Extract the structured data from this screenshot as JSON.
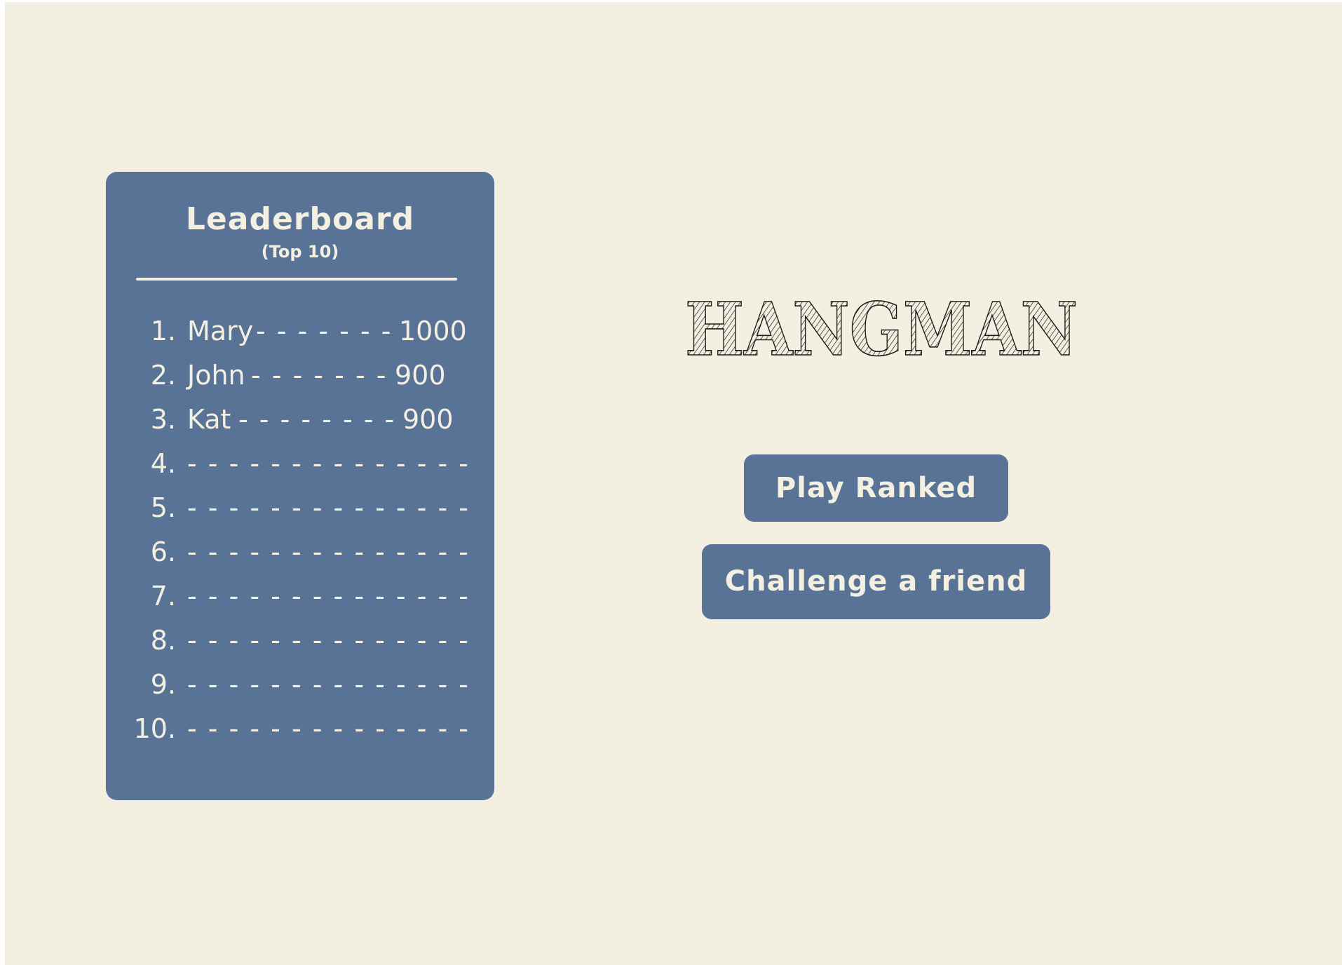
{
  "leaderboard": {
    "title": "Leaderboard",
    "subtitle": "(Top 10)",
    "entries": [
      {
        "rank": "1.",
        "name": "Mary",
        "dashes": "- - - - - - -",
        "score": "1000"
      },
      {
        "rank": "2.",
        "name": "John",
        "dashes": "- - - - - - -",
        "score": "900"
      },
      {
        "rank": "3.",
        "name": "Kat",
        "dashes": "- - - - - - - -",
        "score": "900"
      },
      {
        "rank": "4.",
        "name": "",
        "dashes": "- - - - - - - - - - - - - -",
        "score": ""
      },
      {
        "rank": "5.",
        "name": "",
        "dashes": "- - - - - - - - - - - - - -",
        "score": ""
      },
      {
        "rank": "6.",
        "name": "",
        "dashes": "- - - - - - - - - - - - - -",
        "score": ""
      },
      {
        "rank": "7.",
        "name": "",
        "dashes": "- - - - - - - - - - - - - -",
        "score": ""
      },
      {
        "rank": "8.",
        "name": "",
        "dashes": "- - - - - - - - - - - - - -",
        "score": ""
      },
      {
        "rank": "9.",
        "name": "",
        "dashes": "- - - - - - - - - - - - - -",
        "score": ""
      },
      {
        "rank": "10.",
        "name": "",
        "dashes": "- - - - - - - - - - - - - -",
        "score": ""
      }
    ]
  },
  "game_title": "HANGMAN",
  "buttons": {
    "play_ranked": "Play Ranked",
    "challenge_friend": "Challenge a friend"
  },
  "colors": {
    "background": "#f4f0e1",
    "panel": "#587396",
    "text_light": "#f4f0e1",
    "title_ink": "#1a1a1a"
  }
}
